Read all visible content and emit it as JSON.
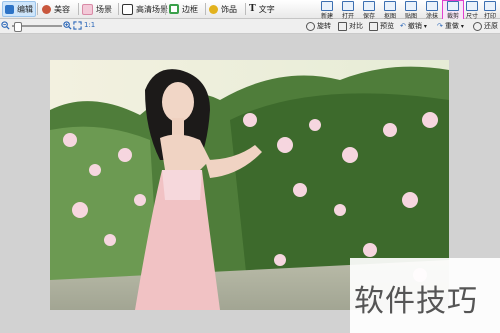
{
  "tabs": [
    {
      "label": "编辑",
      "icon": "edit-icon"
    },
    {
      "label": "美容",
      "icon": "beauty-icon"
    },
    {
      "label": "场景",
      "icon": "scene-icon"
    },
    {
      "label": "高清场景",
      "icon": "hd-scene-icon"
    },
    {
      "label": "边框",
      "icon": "frame-icon"
    },
    {
      "label": "饰品",
      "icon": "accessory-icon"
    },
    {
      "label": "文字",
      "icon": "text-icon"
    }
  ],
  "tools": [
    {
      "label": "新建",
      "icon": "new-icon"
    },
    {
      "label": "打开",
      "icon": "open-icon"
    },
    {
      "label": "保存",
      "icon": "save-icon"
    },
    {
      "label": "抠图",
      "icon": "cutout-icon"
    },
    {
      "label": "贴图",
      "icon": "paste-icon"
    },
    {
      "label": "涂抹",
      "icon": "smear-icon"
    },
    {
      "label": "裁剪",
      "icon": "crop-icon"
    },
    {
      "label": "尺寸",
      "icon": "resize-icon"
    },
    {
      "label": "打印",
      "icon": "print-icon"
    }
  ],
  "zoom": {
    "ratio_label": "1:1",
    "level": 0.1
  },
  "actions": [
    {
      "label": "旋转",
      "icon": "rotate-icon"
    },
    {
      "label": "对比",
      "icon": "compare-icon"
    },
    {
      "label": "预览",
      "icon": "preview-icon"
    },
    {
      "label": "撤销",
      "icon": "undo-icon"
    },
    {
      "label": "重做",
      "icon": "redo-icon"
    },
    {
      "label": "还原",
      "icon": "restore-icon"
    }
  ],
  "watermark": {
    "text": "软件技巧"
  },
  "colors": {
    "accent": "#2a66b8",
    "highlight": "#e040d0",
    "canvas": "#d2d2d2"
  }
}
